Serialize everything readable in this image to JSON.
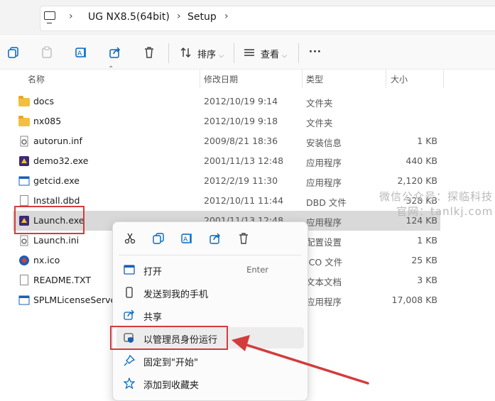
{
  "address": {
    "crumbs": [
      "UG NX8.5(64bit)",
      "Setup"
    ]
  },
  "toolbar": {
    "sort_label": "排序",
    "view_label": "查看",
    "more_label": "···"
  },
  "columns": {
    "name": "名称",
    "date": "修改日期",
    "type": "类型",
    "size": "大小"
  },
  "files": [
    {
      "name": "docs",
      "date": "2012/10/19 9:14",
      "type": "文件夹",
      "size": "",
      "icon": "folder-icon"
    },
    {
      "name": "nx085",
      "date": "2012/10/19 9:18",
      "type": "文件夹",
      "size": "",
      "icon": "folder-icon"
    },
    {
      "name": "autorun.inf",
      "date": "2009/8/21 18:36",
      "type": "安装信息",
      "size": "1 KB",
      "icon": "settings-file-icon"
    },
    {
      "name": "demo32.exe",
      "date": "2001/11/13 12:48",
      "type": "应用程序",
      "size": "440 KB",
      "icon": "app-icon"
    },
    {
      "name": "getcid.exe",
      "date": "2012/2/19 11:30",
      "type": "应用程序",
      "size": "2,120 KB",
      "icon": "window-app-icon"
    },
    {
      "name": "Install.dbd",
      "date": "2012/10/11 11:44",
      "type": "DBD 文件",
      "size": "328 KB",
      "icon": "file-icon"
    },
    {
      "name": "Launch.exe",
      "date": "2001/11/13 12:48",
      "type": "应用程序",
      "size": "124 KB",
      "icon": "app-icon"
    },
    {
      "name": "Launch.ini",
      "date": "",
      "type": "配置设置",
      "size": "1 KB",
      "icon": "settings-file-icon"
    },
    {
      "name": "nx.ico",
      "date": "",
      "type": "ICO 文件",
      "size": "25 KB",
      "icon": "ico-icon"
    },
    {
      "name": "README.TXT",
      "date": "",
      "type": "文本文档",
      "size": "3 KB",
      "icon": "file-icon"
    },
    {
      "name": "SPLMLicenseServer",
      "date": "",
      "type": "应用程序",
      "size": "17,008 KB",
      "icon": "window-app-icon"
    }
  ],
  "watermark": {
    "line1": "微信公众号：探临科技",
    "line2": "官网：tanlkj.com"
  },
  "context_menu": {
    "top_icons": [
      "cut-icon",
      "copy-icon",
      "rename-icon",
      "share-icon",
      "delete-icon"
    ],
    "items": [
      {
        "label": "打开",
        "shortcut": "Enter",
        "icon": "open-icon"
      },
      {
        "label": "发送到我的手机",
        "shortcut": "",
        "icon": "phone-icon"
      },
      {
        "label": "共享",
        "shortcut": "",
        "icon": "share-icon"
      },
      {
        "label": "以管理员身份运行",
        "shortcut": "",
        "icon": "shield-icon"
      },
      {
        "label": "固定到\"开始\"",
        "shortcut": "",
        "icon": "pin-icon"
      },
      {
        "label": "添加到收藏夹",
        "shortcut": "",
        "icon": "star-icon"
      }
    ]
  },
  "colors": {
    "highlight_box": "#d33c3c",
    "selected_row": "#d9d9d9",
    "accent": "#0067c0"
  }
}
